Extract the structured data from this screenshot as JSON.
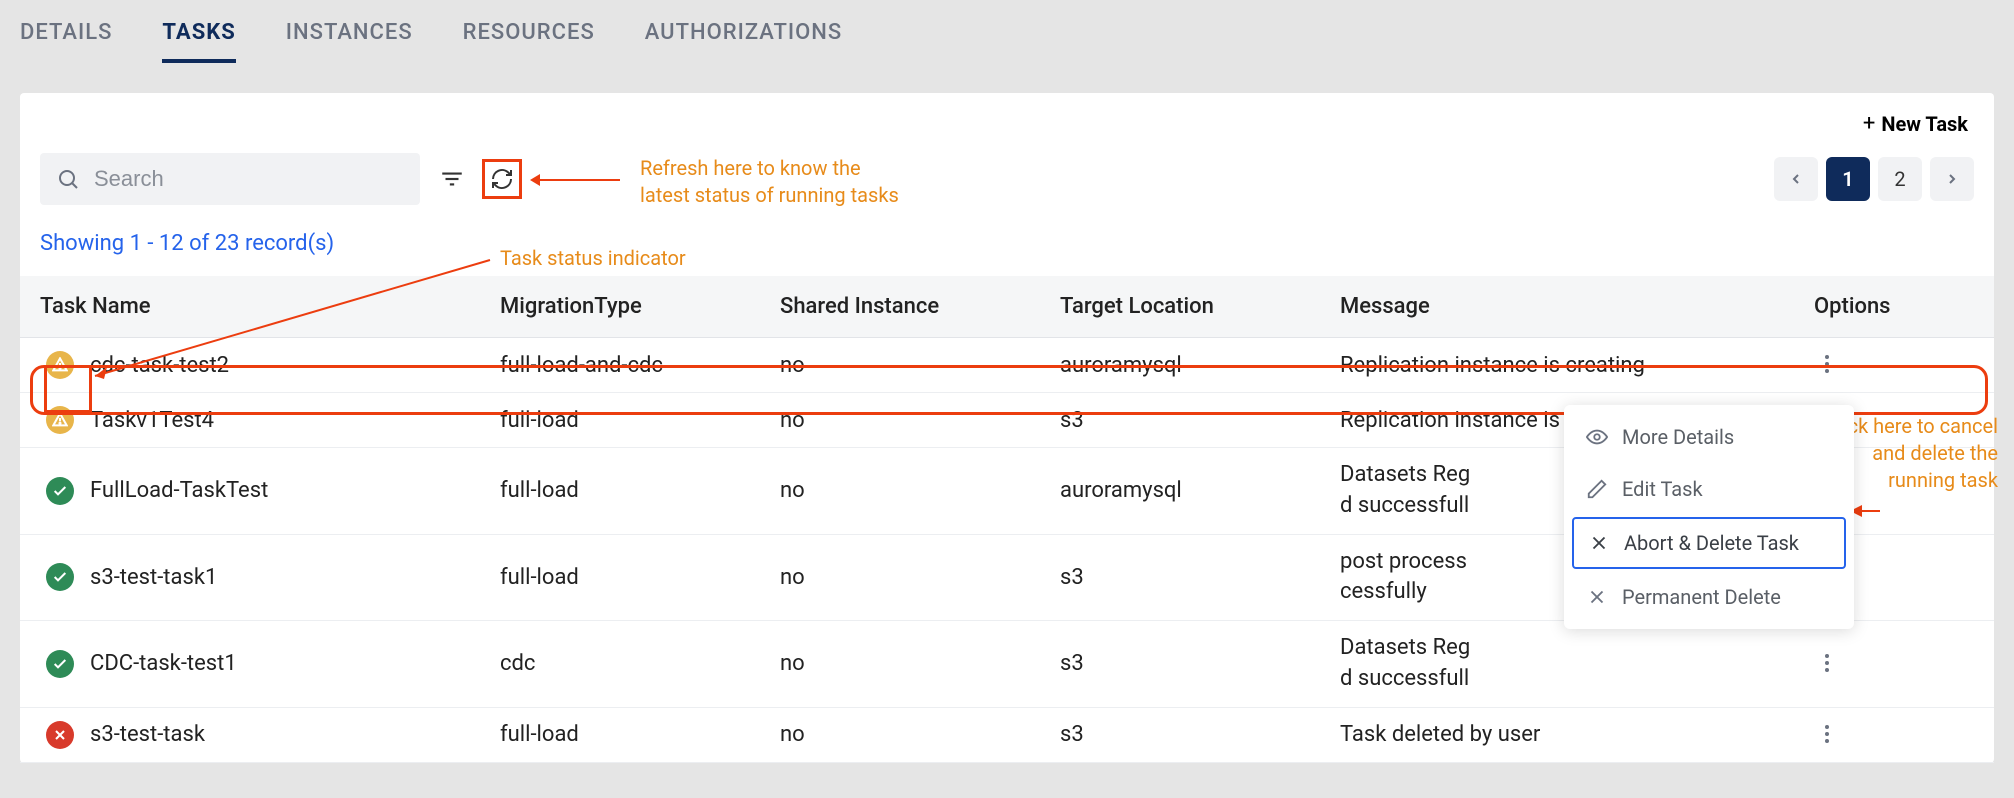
{
  "tabs": {
    "details": "DETAILS",
    "tasks": "TASKS",
    "instances": "INSTANCES",
    "resources": "RESOURCES",
    "authorizations": "AUTHORIZATIONS"
  },
  "newTaskLabel": "New Task",
  "search": {
    "placeholder": "Search"
  },
  "annotations": {
    "refresh": "Refresh here to know the\nlatest status of running tasks",
    "statusIndicator": "Task status indicator",
    "cancelDelete": "Click here to cancel\nand delete the\nrunning task"
  },
  "pagination": {
    "pages": [
      "1",
      "2"
    ],
    "current": "1"
  },
  "showing": "Showing 1 - 12 of 23 record(s)",
  "columns": {
    "name": "Task Name",
    "migration": "MigrationType",
    "shared": "Shared Instance",
    "target": "Target Location",
    "message": "Message",
    "options": "Options"
  },
  "rows": [
    {
      "status": "warn",
      "name": "cdc-task-test2",
      "migration": "full-load-and-cdc",
      "shared": "no",
      "target": "auroramysql",
      "message": "Replication instance is creating"
    },
    {
      "status": "warn",
      "name": "Taskv1Test4",
      "migration": "full-load",
      "shared": "no",
      "target": "s3",
      "message": "Replication instance is creating"
    },
    {
      "status": "ok",
      "name": "FullLoad-TaskTest",
      "migration": "full-load",
      "shared": "no",
      "target": "auroramysql",
      "message": "Datasets Reg\nd successfull"
    },
    {
      "status": "ok",
      "name": "s3-test-task1",
      "migration": "full-load",
      "shared": "no",
      "target": "s3",
      "message": "post process\ncessfully"
    },
    {
      "status": "ok",
      "name": "CDC-task-test1",
      "migration": "cdc",
      "shared": "no",
      "target": "s3",
      "message": "Datasets Reg\nd successfull"
    },
    {
      "status": "error",
      "name": "s3-test-task",
      "migration": "full-load",
      "shared": "no",
      "target": "s3",
      "message": "Task deleted by user"
    }
  ],
  "contextMenu": {
    "moreDetails": "More Details",
    "editTask": "Edit Task",
    "abortDelete": "Abort & Delete Task",
    "permanentDelete": "Permanent Delete"
  }
}
